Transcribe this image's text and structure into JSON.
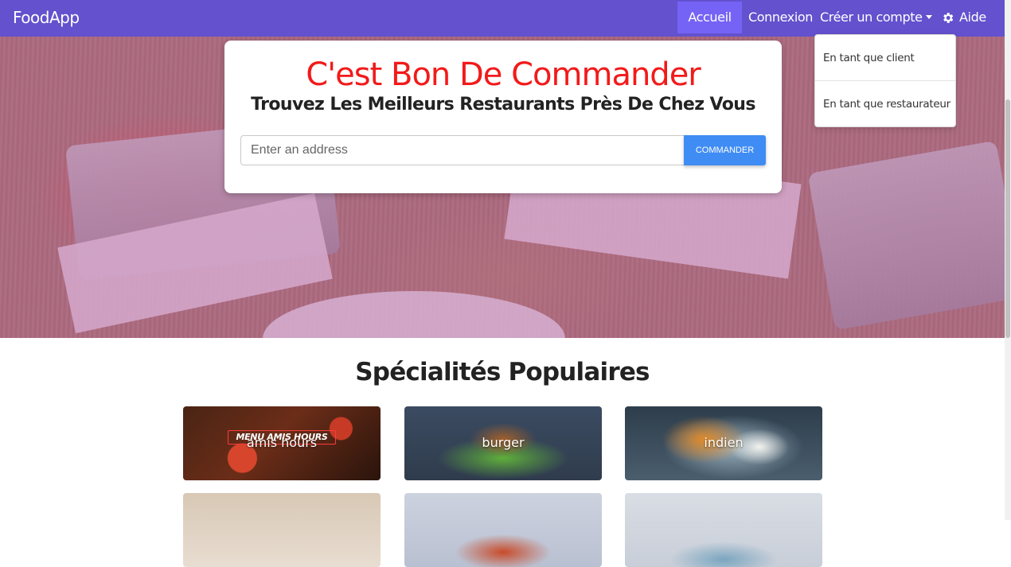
{
  "navbar": {
    "brand": "FoodApp",
    "items": [
      {
        "label": "Accueil",
        "active": true
      },
      {
        "label": "Connexion"
      },
      {
        "label": "Créer un compte"
      },
      {
        "label": "Aide",
        "icon": "gear-icon"
      }
    ]
  },
  "dropdown": {
    "items": [
      "En tant que client",
      "En tant que restaurateur"
    ]
  },
  "hero": {
    "title": "C'est Bon De Commander",
    "subtitle": "Trouvez Les Meilleurs Restaurants Près De Chez Vous",
    "address_placeholder": "Enter an address",
    "button": "COMMANDER"
  },
  "specialites": {
    "title": "Spécialités Populaires",
    "cards": [
      {
        "label": "amis hours",
        "image_text": "MENU AMIS HOURS"
      },
      {
        "label": "burger"
      },
      {
        "label": "indien"
      },
      {
        "label": ""
      },
      {
        "label": ""
      },
      {
        "label": ""
      }
    ]
  },
  "colors": {
    "navbar": "#6351ce",
    "accent_title": "#f21a1a",
    "button": "#3f8cf4"
  }
}
